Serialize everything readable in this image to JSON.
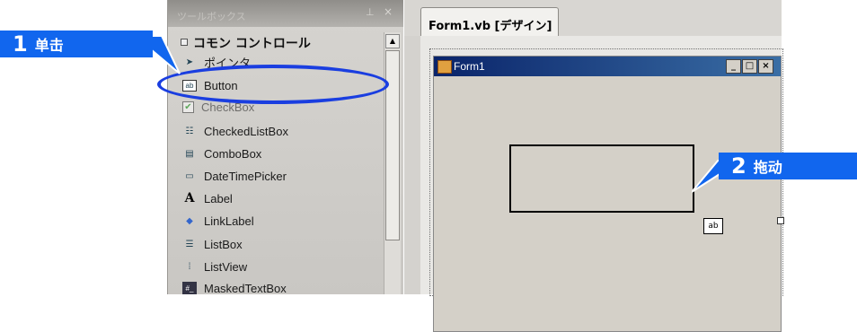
{
  "toolbox": {
    "title": "ツールボックス",
    "group_label": "コモン コントロール",
    "items": [
      {
        "label": "ポインタ",
        "icon": "pointer-icon"
      },
      {
        "label": "Button",
        "icon": "button-icon"
      },
      {
        "label": "CheckBox",
        "icon": "checkbox-icon"
      },
      {
        "label": "CheckedListBox",
        "icon": "checkedlistbox-icon"
      },
      {
        "label": "ComboBox",
        "icon": "combobox-icon"
      },
      {
        "label": "DateTimePicker",
        "icon": "datetimepicker-icon"
      },
      {
        "label": "Label",
        "icon": "label-icon"
      },
      {
        "label": "LinkLabel",
        "icon": "linklabel-icon"
      },
      {
        "label": "ListBox",
        "icon": "listbox-icon"
      },
      {
        "label": "ListView",
        "icon": "listview-icon"
      },
      {
        "label": "MaskedTextBox",
        "icon": "maskedtextbox-icon"
      }
    ]
  },
  "designer": {
    "tab_label": "Form1.vb [デザイン]",
    "form_title": "Form1",
    "cursor_label": "ab"
  },
  "callouts": {
    "step1": {
      "number": "1",
      "text": "单击"
    },
    "step2": {
      "number": "2",
      "text": "拖动"
    }
  },
  "colors": {
    "callout": "#1166ee",
    "highlight_ellipse": "#1a3ee0",
    "form_titlebar": "#0a246a"
  }
}
